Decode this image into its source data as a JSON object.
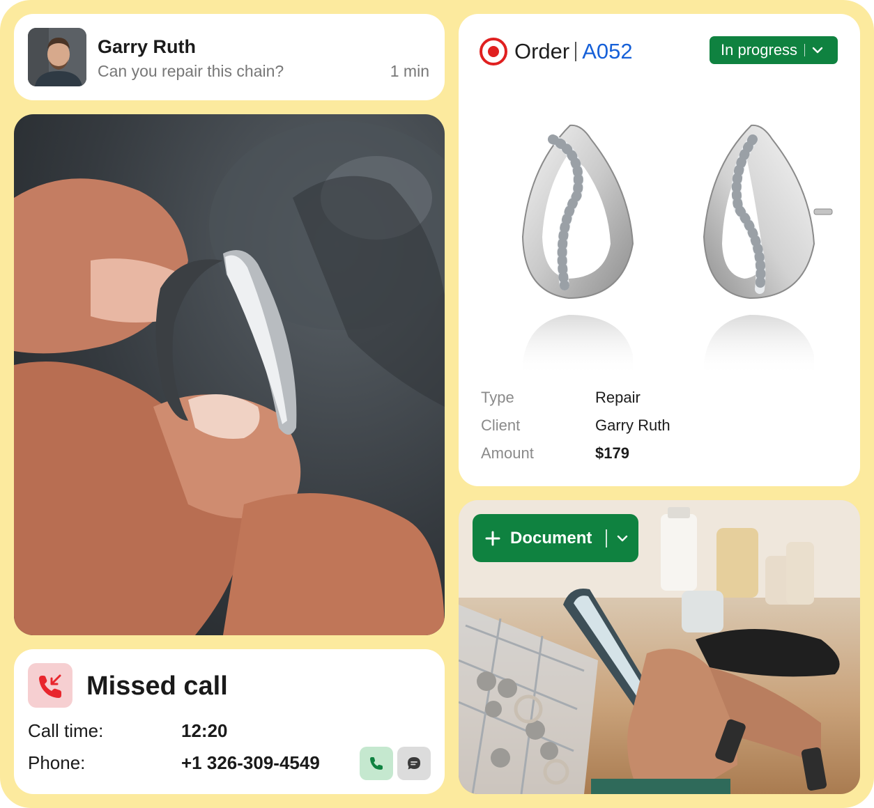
{
  "message": {
    "name": "Garry Ruth",
    "text": "Can you repair this chain?",
    "time": "1 min"
  },
  "order": {
    "label": "Order",
    "id": "A052",
    "status": "In progress",
    "details": [
      {
        "label": "Type",
        "value": "Repair"
      },
      {
        "label": "Client",
        "value": "Garry Ruth"
      },
      {
        "label": "Amount",
        "value": "$179"
      }
    ]
  },
  "call": {
    "title": "Missed call",
    "time_label": "Call time:",
    "time_value": "12:20",
    "phone_label": "Phone:",
    "phone_value": "+1 326-309-4549"
  },
  "document_button": {
    "label": "Document"
  },
  "colors": {
    "background": "#fcea9e",
    "accent_green": "#0f8240",
    "order_id_blue": "#1660d8",
    "target_red": "#e02020",
    "missed_red": "#e8262d"
  },
  "icons": [
    "target-icon",
    "chevron-down-icon",
    "plus-icon",
    "missed-call-icon",
    "phone-icon",
    "chat-icon"
  ]
}
